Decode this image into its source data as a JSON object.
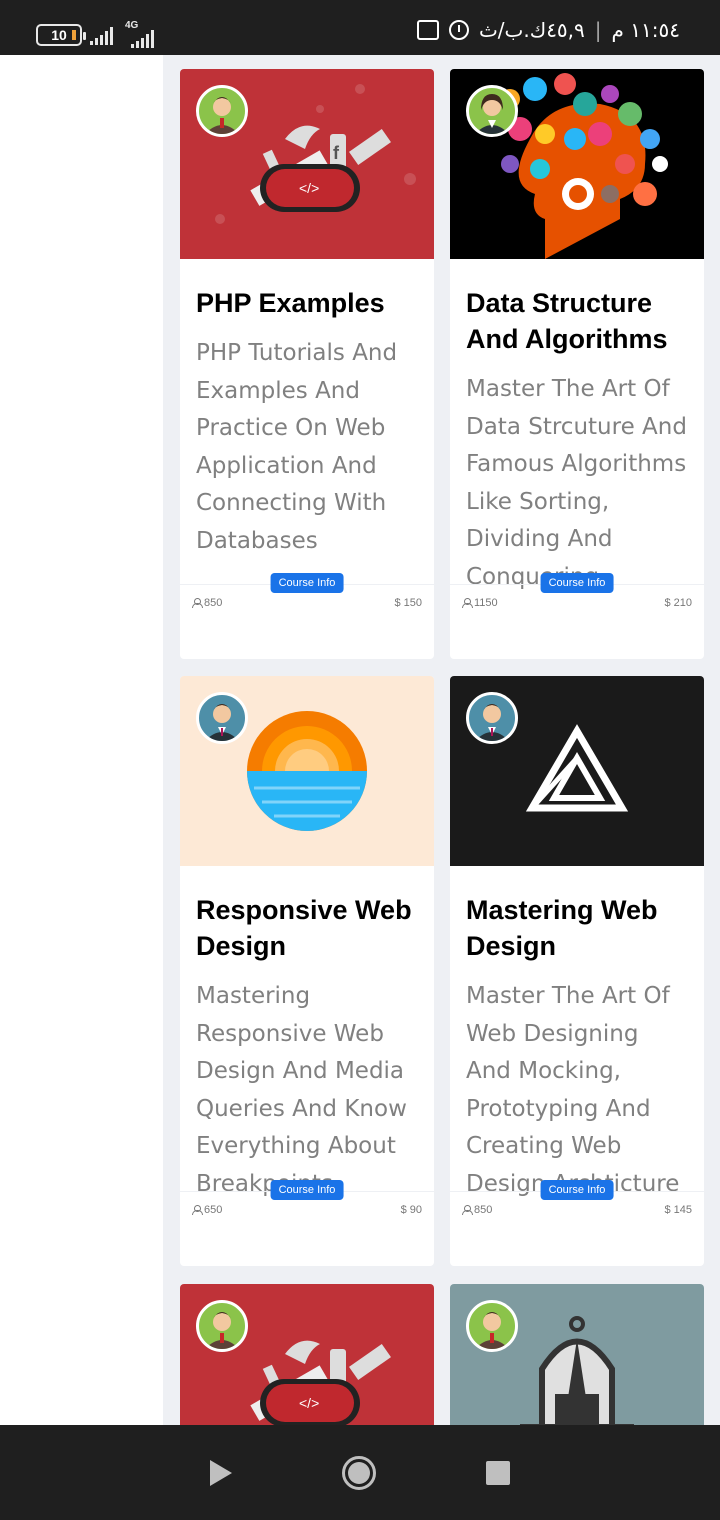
{
  "status_bar": {
    "battery": "10",
    "network": "4G",
    "time": "١١:٥٤ م",
    "speed": "٤٥,٩ك.ب/ث"
  },
  "courses": [
    {
      "title": "PHP Examples",
      "description": "PHP Tutorials And Examples And Practice On Web Application And Connecting With Databases",
      "button": "Course Info",
      "students": "850",
      "price": "$ 150",
      "thumb_bg": "#bf3238"
    },
    {
      "title": "Data Structure And Algorithms",
      "description": "Master The Art Of Data Strcuture And Famous Algorithms Like Sorting, Dividing And Conquering",
      "button": "Course Info",
      "students": "1150",
      "price": "$ 210",
      "thumb_bg": "#000000"
    },
    {
      "title": "Responsive Web Design",
      "description": "Mastering Responsive Web Design And Media Queries And Know Everything About Breakpoints",
      "button": "Course Info",
      "students": "650",
      "price": "$ 90",
      "thumb_bg": "#fde9d6"
    },
    {
      "title": "Mastering Web Design",
      "description": "Master The Art Of Web Designing And Mocking, Prototyping And Creating Web Design Archticture",
      "button": "Course Info",
      "students": "850",
      "price": "$ 145",
      "thumb_bg": "#1a1a1a"
    },
    {
      "thumb_bg": "#bf3238"
    },
    {
      "thumb_bg": "#7f9ba0"
    }
  ]
}
